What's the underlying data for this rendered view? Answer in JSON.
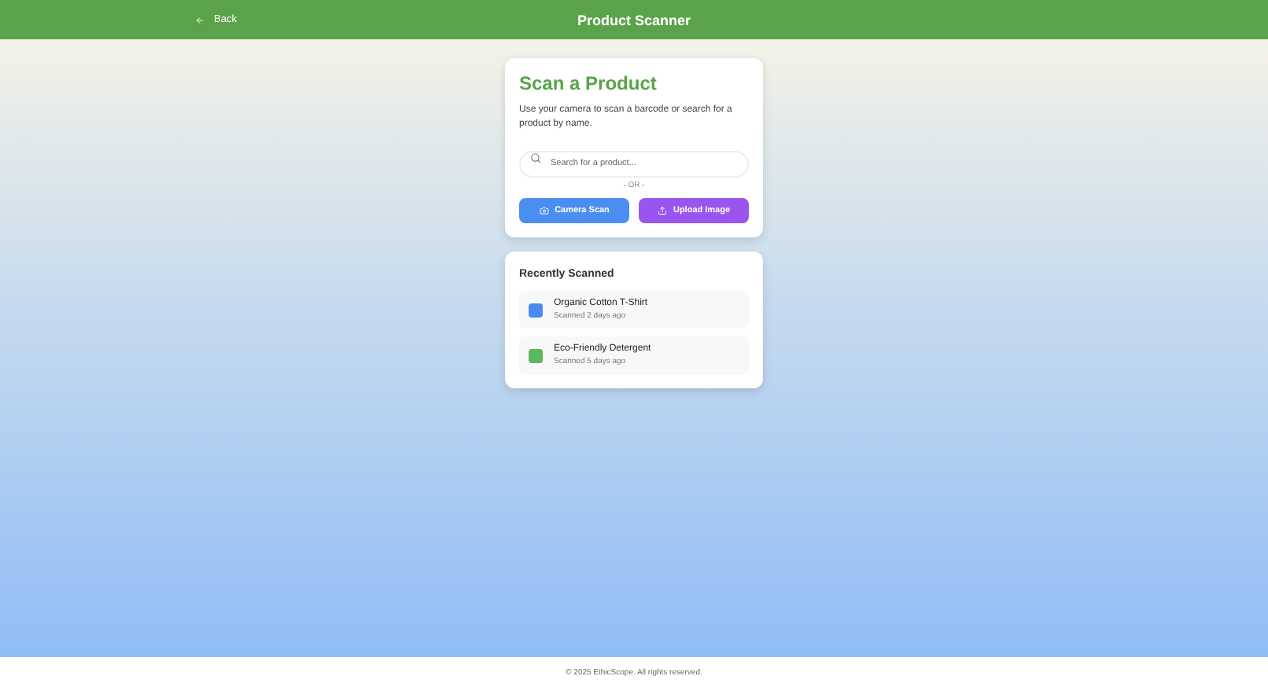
{
  "header": {
    "back": "Back",
    "title": "Product Scanner"
  },
  "scan": {
    "title": "Scan a Product",
    "description": "Use your camera to scan a barcode or search for a product by name.",
    "search": {
      "placeholder": "Search for a product..."
    },
    "divider": "- OR -",
    "buttons": [
      {
        "kind": "camera",
        "label": "Camera Scan"
      },
      {
        "kind": "upload",
        "label": "Upload Image"
      }
    ]
  },
  "recent": {
    "title": "Recently Scanned",
    "items": [
      {
        "name": "Organic Cotton T-Shirt",
        "time": "Scanned 2 days ago",
        "color": "#4a8af0"
      },
      {
        "name": "Eco-Friendly Detergent",
        "time": "Scanned 5 days ago",
        "color": "#5cb85c"
      }
    ]
  },
  "footer": "© 2025 EthicScope. All rights reserved."
}
